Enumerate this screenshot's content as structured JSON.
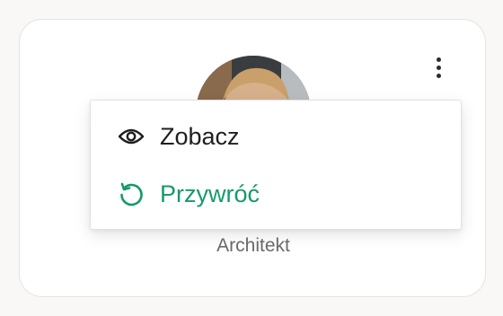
{
  "card": {
    "role": "Architekt"
  },
  "menu": {
    "items": [
      {
        "label": "Zobacz",
        "icon": "eye-icon",
        "color": "#1f1f1f"
      },
      {
        "label": "Przywróć",
        "icon": "restore-icon",
        "color": "#149a6b"
      }
    ]
  },
  "colors": {
    "accent": "#149a6b",
    "text_muted": "#6b6b6b",
    "card_border": "#e6e3e0"
  }
}
